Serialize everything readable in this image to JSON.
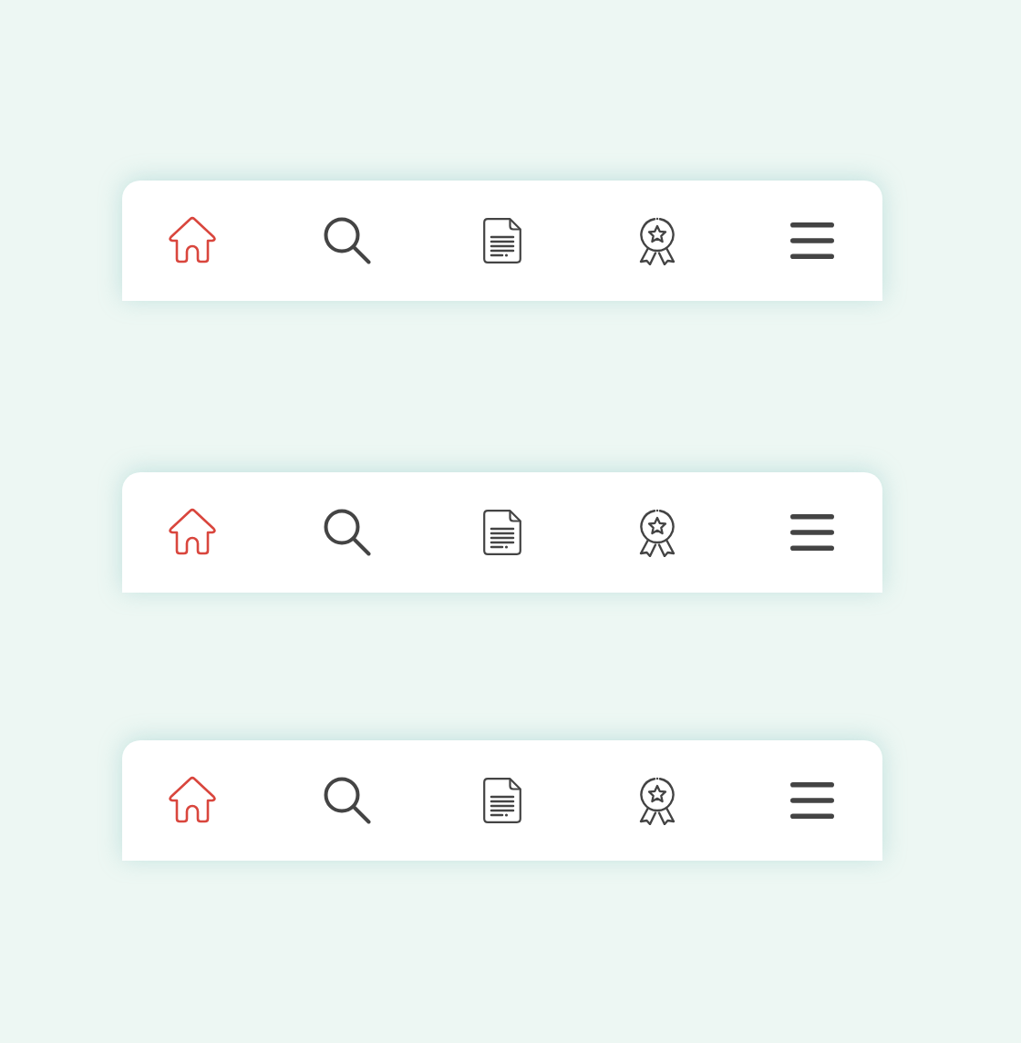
{
  "bars": [
    {
      "items": [
        {
          "kind": "home",
          "selected": true
        },
        {
          "kind": "search",
          "selected": false
        },
        {
          "kind": "document",
          "selected": false
        },
        {
          "kind": "award",
          "selected": false
        },
        {
          "kind": "menu",
          "selected": false
        }
      ]
    },
    {
      "items": [
        {
          "kind": "home",
          "selected": true
        },
        {
          "kind": "search",
          "selected": false
        },
        {
          "kind": "document",
          "selected": false
        },
        {
          "kind": "award",
          "selected": false
        },
        {
          "kind": "menu",
          "selected": false
        }
      ]
    },
    {
      "items": [
        {
          "kind": "home",
          "selected": true
        },
        {
          "kind": "search",
          "selected": false
        },
        {
          "kind": "document",
          "selected": false
        },
        {
          "kind": "award",
          "selected": false
        },
        {
          "kind": "menu",
          "selected": false
        }
      ]
    }
  ]
}
